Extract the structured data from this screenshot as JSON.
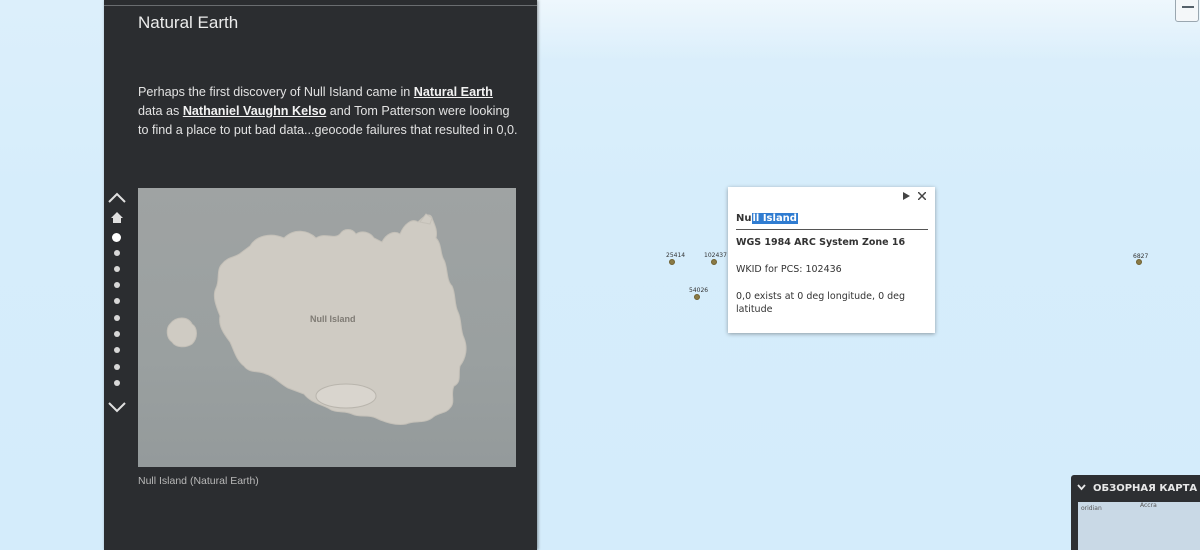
{
  "panel": {
    "title": "Natural Earth",
    "body": {
      "p1": "Perhaps the first discovery of Null Island came in ",
      "link1": "Natural Earth",
      "p2": " data as ",
      "link2": "Nathaniel Vaughn Kelso",
      "p3": " and Tom Patterson were looking to find a place to put bad data...geocode failures that resulted in 0,0."
    },
    "figure_label": "Null Island",
    "caption": "Null Island (Natural Earth)"
  },
  "navigator": {
    "up_icon": "chevron-up-icon",
    "home_icon": "home-icon",
    "dot_count": 11,
    "active_index": 0,
    "down_icon": "chevron-down-icon"
  },
  "map": {
    "points": [
      {
        "label": "25414"
      },
      {
        "label": "102437"
      },
      {
        "label": "54026"
      },
      {
        "label": "6827"
      }
    ]
  },
  "popup": {
    "title_prefix": "Nu",
    "title_selected": "ll Island",
    "line1": "WGS 1984 ARC System Zone 16",
    "line2": "WKID for PCS: 102436",
    "line3": "0,0 exists at 0 deg longitude, 0 deg latitude",
    "next_icon": "play-icon",
    "close_icon": "close-icon"
  },
  "overview": {
    "title": "ОБЗОРНАЯ КАРТА",
    "mini_label_left": "oridian",
    "mini_label_right": "Accra"
  },
  "colors": {
    "panel_bg": "#2b2d30",
    "ocean": "#d4ecfb",
    "selection": "#2f7cd1"
  }
}
